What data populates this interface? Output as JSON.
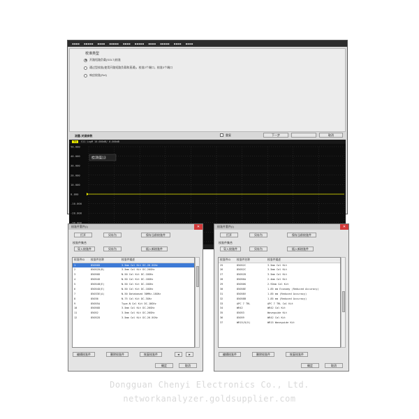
{
  "main_window": {
    "menu_items": [
      "▪▪▪▪",
      "▪▪▪▪▪",
      "▪▪▪▪",
      "▪▪▪▪▪",
      "▪▪▪▪",
      "▪▪▪▪▪",
      "▪▪▪▪",
      "▪▪▪▪▪",
      "▪▪▪▪",
      "▪▪▪▪"
    ],
    "config_title": "校准类型",
    "radio_options": [
      {
        "label": "开路短路负载(SOLT)校准",
        "selected": true
      },
      {
        "label": "通过型校准(使用开路短路负载和直通)，校准2个端口，校准3个端口",
        "selected": false
      },
      {
        "label": "响应校准(Ref)",
        "selected": false
      }
    ],
    "section_label": "测量-关键参数",
    "checkbox_label": "重复",
    "btn_next": "下一步",
    "btn_blank": "",
    "btn_cancel": "取消",
    "plot": {
      "tag": "Tr1",
      "trace_info": "S11 LogM 10.000dB/ 0.000dB",
      "marker_label": "检测值13",
      "status_left": "开始 10.000MHz",
      "status_mid": "IFBW 1kHz  功率 0dBm  扫描 201",
      "status_right": "停止 10.000GHz",
      "y_ticks": [
        "50.000",
        "40.000",
        "30.000",
        "20.000",
        "10.000",
        "0.000",
        "-10.000",
        "-20.000",
        "-30.000",
        "-40.000",
        "-50.000"
      ]
    }
  },
  "dialog_left": {
    "title": "校准件套件(I)",
    "btn_row1": [
      "打开",
      "另存为",
      "保存当前校准件"
    ],
    "group_label": "校准件集合",
    "btn_row2": [
      "导入校准件",
      "另存为",
      "插入新校准件"
    ],
    "columns": [
      "校准件ID",
      "校准件名称",
      "校准件描述"
    ],
    "rows": [
      [
        "1",
        "85056D",
        "3.5mm Cal Kit DC-26.5GHz"
      ],
      [
        "2",
        "85052D(B)",
        "3.5mm Cal Kit DC-26GHz"
      ],
      [
        "3",
        "85050D",
        "N-50 Cal Kit DC-18GHz"
      ],
      [
        "4",
        "85054D",
        "N-50 Cal Kit DC-18GHz"
      ],
      [
        "5",
        "85054B(E)",
        "N-50 Cal Kit DC-18GHz"
      ],
      [
        "6",
        "85054D(E)",
        "N-50 Cal Kit DC-18GHz"
      ],
      [
        "7",
        "85033E(A)",
        "N-50 Databased 30MHz-18GHz"
      ],
      [
        "8",
        "85036",
        "N-75 Cal Kit DC-3GHz"
      ],
      [
        "9",
        "85055A",
        "Type-N Cal Kit DC-18GHz"
      ],
      [
        "10",
        "85050D",
        "3.5mm Cal Kit DC-26GHz"
      ],
      [
        "11",
        "85052",
        "3.5mm Cal Kit DC-26GHz"
      ],
      [
        "12",
        "85052D",
        "3.5mm Cal Kit DC-26.5GHz"
      ]
    ],
    "selected_row": 0,
    "scroll_thumb_top": 12,
    "scroll_thumb_height": 30,
    "bottom_buttons": [
      "编辑校准件",
      "删除校准件",
      "恢复校准件",
      "◄",
      "►"
    ],
    "btn_ok": "确定",
    "btn_cancel": "取消"
  },
  "dialog_right": {
    "title": "校准件套件(I)",
    "btn_row1": [
      "打开",
      "另存为",
      "保存当前校准件"
    ],
    "group_label": "校准件集合",
    "btn_row2": [
      "导入校准件",
      "另存为",
      "插入新校准件"
    ],
    "columns": [
      "校准件ID",
      "校准件名称",
      "校准件描述"
    ],
    "rows": [
      [
        "25",
        "85052C",
        "3.5mm Cal Kit"
      ],
      [
        "26",
        "85052C",
        "3.5mm Cal Kit"
      ],
      [
        "27",
        "85052D",
        "3.5mm Cal Kit"
      ],
      [
        "28",
        "85056A",
        "2.4mm Cal Kit"
      ],
      [
        "29",
        "85056K",
        "2.92mm Cal Kit"
      ],
      [
        "30",
        "85058E",
        "1.85 mm Economy (Reduced Accuracy)"
      ],
      [
        "31",
        "85058V",
        "1.85 mm (Reduced Accuracy)"
      ],
      [
        "32",
        "85058B",
        "1.85 mm (Reduced Accuracy)"
      ],
      [
        "33",
        "APC 7 TRL",
        "APC 7 TRL Cal Kit"
      ],
      [
        "34",
        "WR42",
        "WR42 Cal Kit"
      ],
      [
        "35",
        "85053",
        "Waveguide Kit"
      ],
      [
        "36",
        "85059",
        "WR42 Cal Kit"
      ],
      [
        "37",
        "WR15(R/X)",
        "WR15 Waveguide Kit"
      ]
    ],
    "selected_row": -1,
    "scroll_thumb_top": 48,
    "scroll_thumb_height": 30,
    "bottom_buttons": [
      "编辑校准件",
      "删除校准件",
      "恢复校准件"
    ],
    "btn_ok": "确定",
    "btn_cancel": "取消"
  },
  "footer": {
    "company": "Dongguan Chenyi Electronics Co., Ltd.",
    "site": "networkanalyzer.goldsupplier.com"
  },
  "colors": {
    "plot_bg": "#0d0d0d",
    "grid": "#3a3a3a",
    "trace": "#f0f000",
    "selection": "#3d7ad6"
  }
}
